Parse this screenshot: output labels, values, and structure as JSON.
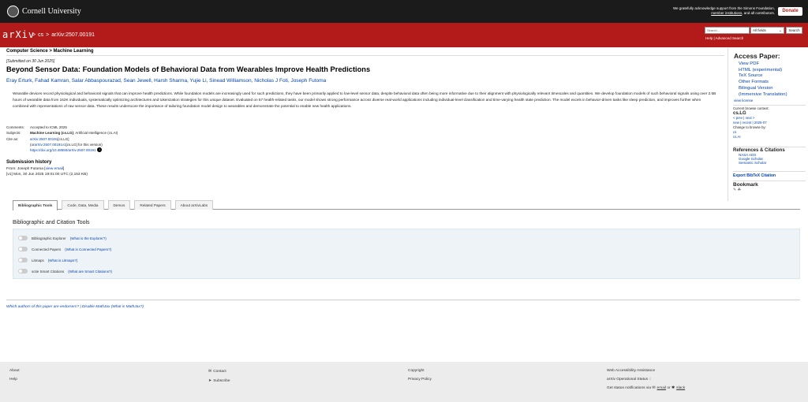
{
  "topbar": {
    "institution": "Cornell University",
    "support_line1": "We gratefully acknowledge support from the Simons Foundation,",
    "support_line2_link": "member institutions",
    "support_line2_rest": ", and all contributors.",
    "donate": "Donate"
  },
  "header": {
    "logo": "arXiv",
    "crumbs": [
      ">",
      "cs",
      ">",
      "arXiv:2507.00191"
    ],
    "search_placeholder": "Search...",
    "search_field": "All fields",
    "search_button": "Search",
    "help": "Help | Advanced Search"
  },
  "paper": {
    "subject_bar": "Computer Science > Machine Learning",
    "submitted": "[Submitted on 30 Jun 2025]",
    "title": "Beyond Sensor Data: Foundation Models of Behavioral Data from Wearables Improve Health Predictions",
    "authors": "Eray Erturk, Fahad Kamran, Salar Abbaspourazad, Sean Jewell, Harsh Sharma, Yujie Li, Sinead Williamson, Nicholas J Foti, Joseph Futoma",
    "abstract": "Wearable devices record physiological and behavioral signals that can improve health predictions. While foundation models are increasingly used for such predictions, they have been primarily applied to low-level sensor data, despite behavioral data often being more informative due to their alignment with physiologically relevant timescales and quantities. We develop foundation models of such behavioral signals using over 2.5B hours of wearable data from 162K individuals, systematically optimizing architectures and tokenization strategies for this unique dataset. Evaluated on 57 health-related tasks, our model shows strong performance across diverse real-world applications including individual-level classification and time-varying health state prediction. The model excels in behavior-driven tasks like sleep prediction, and improves further when combined with representations of raw sensor data. These results underscore the importance of tailoring foundation model design to wearables and demonstrate the potential to enable new health applications."
  },
  "meta": {
    "comments_k": "Comments:",
    "comments_v": "Accepted to ICML 2025",
    "subjects_k": "Subjects:",
    "subjects_bold": "Machine Learning (cs.LG)",
    "subjects_rest": "; Artificial Intelligence (cs.AI)",
    "cite_k": "Cite as:",
    "cite_link": "arXiv:2507.00191",
    "cite_rest": " [cs.LG]",
    "cite2_pre": "(or ",
    "cite2_link": "arXiv:2507.00191v1",
    "cite2_rest": " [cs.LG] for this version)",
    "doi": "https://doi.org/10.48550/arXiv.2507.00191"
  },
  "history": {
    "title": "Submission history",
    "from_pre": "From: Joseph Futoma [",
    "from_link": "view email",
    "from_post": "]",
    "v1": "[v1] Mon, 30 Jun 2025 19:01:00 UTC (2,153 KB)"
  },
  "tabs": [
    "Bibliographic Tools",
    "Code, Data, Media",
    "Demos",
    "Related Papers",
    "About arXivLabs"
  ],
  "tools": {
    "title": "Bibliographic and Citation Tools",
    "rows": [
      {
        "label": "Bibliographic Explorer",
        "link": "(What is the Explorer?)"
      },
      {
        "label": "Connected Papers",
        "link": "(What is Connected Papers?)"
      },
      {
        "label": "Litmaps",
        "link": "(What is Litmaps?)"
      },
      {
        "label": "scite Smart Citations",
        "link": "(What are Smart Citations?)"
      }
    ]
  },
  "endorse": "Which authors of this paper are endorsers? | Disable MathJax (What is MathJax?)",
  "sidebar": {
    "access_title": "Access Paper:",
    "access": [
      "View PDF",
      "HTML (experimental)",
      "TeX Source",
      "Other Formats",
      "Bilingual Version",
      "(Immersive Translation)"
    ],
    "license": "view license",
    "ctx_title": "Current browse context:",
    "ctx_cat": "cs.LG",
    "ctx_nav": "< prev   |   next >",
    "ctx_nav2": "new | recent | 2025-07",
    "ctx_change": "Change to browse by:",
    "ctx_cs": "cs",
    "ctx_csai": "cs.AI",
    "refs_title": "References & Citations",
    "refs": [
      "NASA ADS",
      "Google Scholar",
      "Semantic Scholar"
    ],
    "bibtex": "Export BibTeX Citation",
    "bookmark": "Bookmark"
  },
  "footer": {
    "about": "About",
    "help": "Help",
    "contact": "Contact",
    "subscribe": "Subscribe",
    "copyright": "Copyright",
    "privacy": "Privacy Policy",
    "accessibility": "Web Accessibility Assistance",
    "status": "arXiv Operational Status",
    "notify_pre": "Get status notifications via",
    "notify_email": "email",
    "notify_or": "or",
    "notify_slack": "slack"
  }
}
